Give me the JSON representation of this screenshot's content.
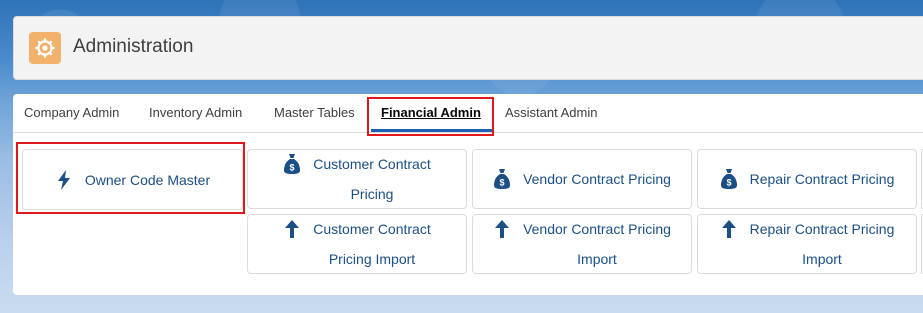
{
  "header": {
    "title": "Administration",
    "icon": "gear-icon",
    "icon_color": "#f1b36b"
  },
  "tabs": [
    {
      "label": "Company Admin"
    },
    {
      "label": "Inventory Admin"
    },
    {
      "label": "Master Tables"
    },
    {
      "label": "Financial Admin",
      "active": true
    },
    {
      "label": "Assistant Admin"
    }
  ],
  "tiles": {
    "owner_code_master": {
      "line1": "Owner Code Master",
      "icon": "lightning-icon"
    },
    "customer_contract_pricing": {
      "line1": "Customer Contract",
      "line2": "Pricing",
      "icon": "money-bag-icon"
    },
    "vendor_contract_pricing": {
      "line1": "Vendor Contract Pricing",
      "icon": "money-bag-icon"
    },
    "repair_contract_pricing": {
      "line1": "Repair Contract Pricing",
      "icon": "money-bag-icon"
    },
    "customer_contract_pricing_import": {
      "line1": "Customer Contract",
      "line2": "Pricing Import",
      "icon": "arrow-up-icon"
    },
    "vendor_contract_pricing_import": {
      "line1": "Vendor Contract Pricing",
      "line2": "Import",
      "icon": "arrow-up-icon"
    },
    "repair_contract_pricing_import": {
      "line1": "Repair Contract Pricing",
      "line2": "Import",
      "icon": "arrow-up-icon"
    }
  },
  "colors": {
    "accent": "#1b5fb0",
    "tile_text": "#1b4f86",
    "highlight": "#e0181c"
  }
}
